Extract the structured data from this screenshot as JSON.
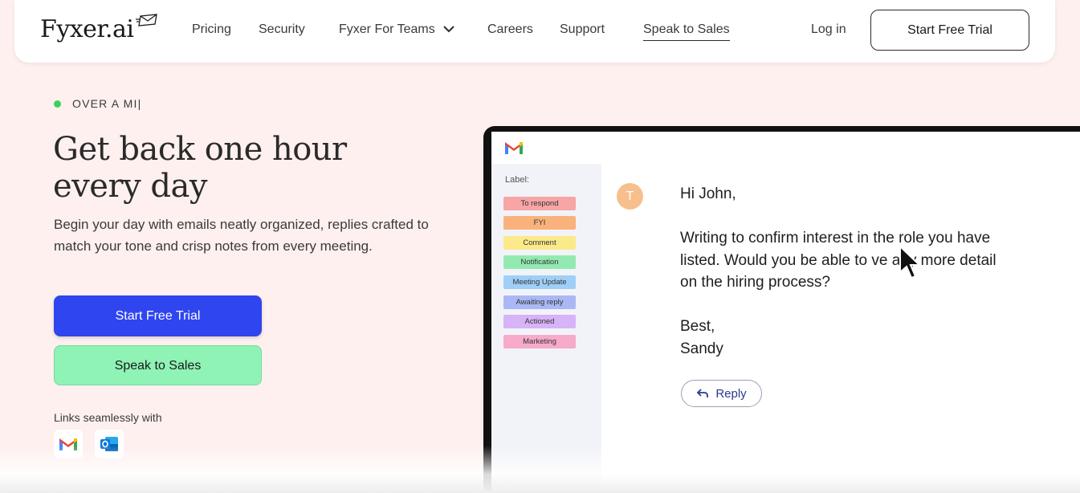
{
  "nav": {
    "logo_text": "Fyxer.ai",
    "links": {
      "pricing": "Pricing",
      "security": "Security",
      "teams": "Fyxer For Teams",
      "careers": "Careers",
      "support": "Support",
      "sales": "Speak to Sales"
    },
    "login": "Log in",
    "trial": "Start Free Trial"
  },
  "hero": {
    "badge": "OVER A MI|",
    "headline_line1": "Get back one hour",
    "headline_line2": "every day",
    "subtext": "Begin your day with emails neatly organized, replies crafted to match your tone and crisp notes from every meeting.",
    "primary_button": "Start Free Trial",
    "secondary_button": "Speak to Sales",
    "links_label": "Links seamlessly with"
  },
  "mockup": {
    "label_title": "Label:",
    "labels": [
      {
        "name": "To respond",
        "color": "#f7a5a5"
      },
      {
        "name": "FYI",
        "color": "#f9b27c"
      },
      {
        "name": "Comment",
        "color": "#fbe98a"
      },
      {
        "name": "Notification",
        "color": "#93eab0"
      },
      {
        "name": "Meeting Update",
        "color": "#9fcff7"
      },
      {
        "name": "Awaiting reply",
        "color": "#aab8f5"
      },
      {
        "name": "Actioned",
        "color": "#d7b3f7"
      },
      {
        "name": "Marketing",
        "color": "#f7aacc"
      }
    ],
    "avatar_letter": "T",
    "email": {
      "greeting": "Hi John,",
      "body_line1": "Writing to confirm interest in the role you have",
      "body_line2": "listed. Would you be able to  ve any more detail",
      "body_line3": "on the hiring process?",
      "signoff": "Best,",
      "signature": "Sandy"
    },
    "reply_label": "Reply"
  },
  "colors": {
    "primary": "#2f45f0",
    "secondary": "#8ef3b5",
    "background": "#fdf0ee",
    "badge_dot": "#3fcf5b"
  },
  "icons": [
    "logo-envelope-icon",
    "chevron-down-icon",
    "gmail-icon",
    "outlook-icon",
    "reply-arrow-icon",
    "mouse-cursor-icon"
  ]
}
